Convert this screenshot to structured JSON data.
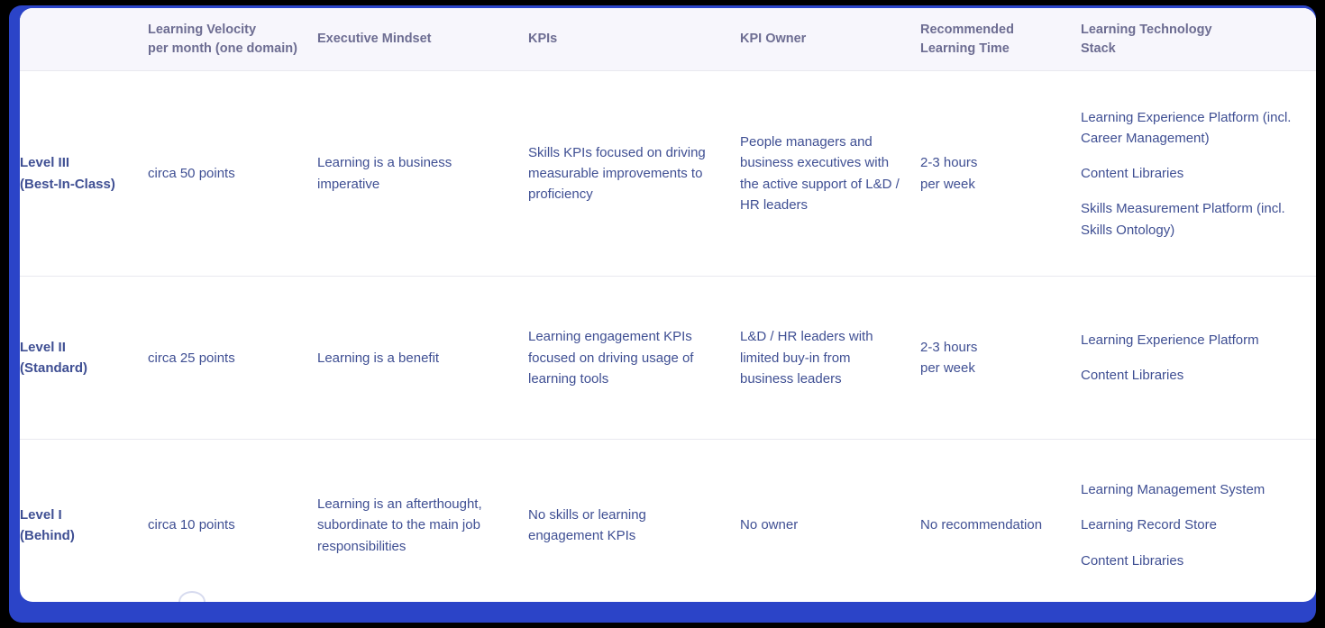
{
  "theme": {
    "frame_color": "#2b44c8",
    "card_background": "#ffffff",
    "header_background": "#f7f6fc",
    "header_text_color": "#6d6d92",
    "body_text_color": "#3f4f93",
    "level_text_color": "#32407e",
    "divider_color": "#e8e8ef"
  },
  "table": {
    "columns": [
      {
        "key": "level",
        "label": ""
      },
      {
        "key": "velocity",
        "label_line1": "Learning Velocity",
        "label_line2": "per month (one domain)"
      },
      {
        "key": "mindset",
        "label_line1": "Executive Mindset",
        "label_line2": ""
      },
      {
        "key": "kpis",
        "label_line1": "KPIs",
        "label_line2": ""
      },
      {
        "key": "kpi_owner",
        "label_line1": "KPI Owner",
        "label_line2": ""
      },
      {
        "key": "learning_time",
        "label_line1": "Recommended",
        "label_line2": "Learning Time"
      },
      {
        "key": "tech_stack",
        "label_line1": "Learning Technology",
        "label_line2": "Stack"
      }
    ],
    "rows": [
      {
        "level_line1": "Level III",
        "level_line2": "(Best-In-Class)",
        "velocity": "circa 50 points",
        "mindset": "Learning is a business imperative",
        "kpis": "Skills KPIs focused on driving measurable improvements to proficiency",
        "kpi_owner": "People managers and business executives with the active support of L&D / HR leaders",
        "learning_time_line1": "2-3 hours",
        "learning_time_line2": "per week",
        "tech_stack": [
          "Learning Experience Platform (incl. Career Management)",
          "Content Libraries",
          "Skills Measurement Platform (incl. Skills Ontology)"
        ]
      },
      {
        "level_line1": "Level II",
        "level_line2": "(Standard)",
        "velocity": "circa 25 points",
        "mindset": "Learning is a benefit",
        "kpis": "Learning engagement KPIs focused on driving usage of learning tools",
        "kpi_owner": "L&D / HR leaders with limited buy-in from business leaders",
        "learning_time_line1": "2-3 hours",
        "learning_time_line2": "per week",
        "tech_stack": [
          "Learning Experience Platform",
          "Content Libraries"
        ]
      },
      {
        "level_line1": "Level I",
        "level_line2": "(Behind)",
        "velocity": "circa 10 points",
        "mindset": "Learning is an afterthought, subordinate to the main job responsibilities",
        "kpis": "No skills or learning engagement KPIs",
        "kpi_owner": "No owner",
        "learning_time_line1": "No recommendation",
        "learning_time_line2": "",
        "tech_stack": [
          "Learning Management System",
          "Learning Record Store",
          "Content Libraries"
        ]
      }
    ]
  }
}
